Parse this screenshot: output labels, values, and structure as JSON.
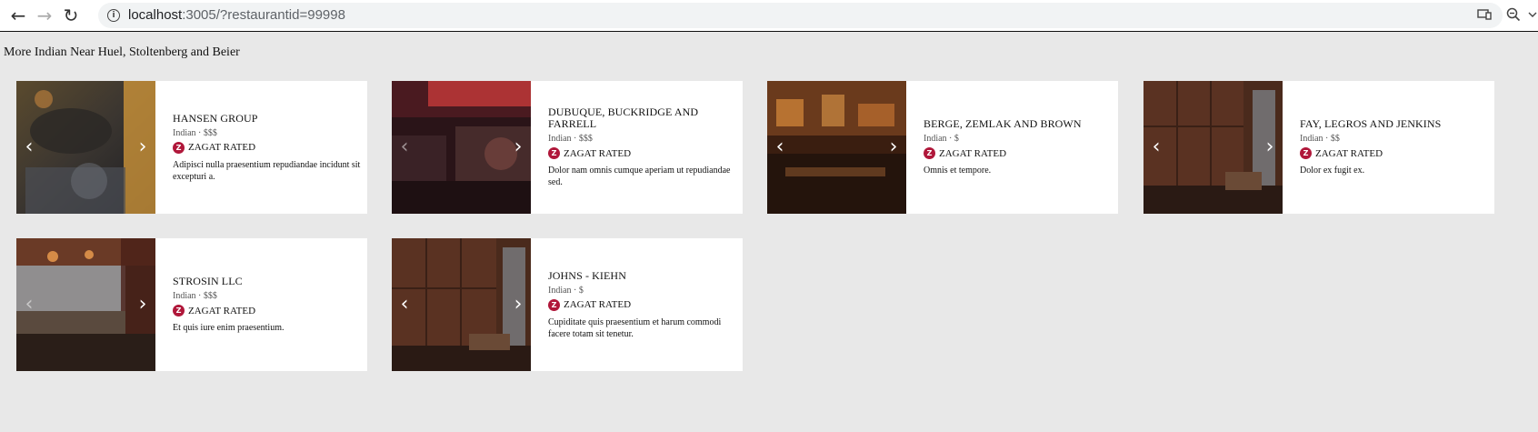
{
  "browser": {
    "back_icon": "←",
    "forward_icon": "→",
    "reload_icon": "↻",
    "url_host": "localhost",
    "url_path": ":3005/?restaurantid=99998"
  },
  "section": {
    "title": "More Indian Near Huel, Stoltenberg and Beier"
  },
  "zagat_label": "ZAGAT RATED",
  "cards": [
    {
      "name": "Hansen Group",
      "meta": "Indian · $$$",
      "zagat": "ZAGAT RATED",
      "description": "Adipisci nulla praesentium repudiandae incidunt sit excepturi a."
    },
    {
      "name": "Dubuque, Buckridge and Farrell",
      "meta": "Indian · $$$",
      "zagat": "ZAGAT RATED",
      "description": "Dolor nam omnis cumque aperiam ut repudiandae sed."
    },
    {
      "name": "Berge, Zemlak and Brown",
      "meta": "Indian · $",
      "zagat": "ZAGAT RATED",
      "description": "Omnis et tempore."
    },
    {
      "name": "Fay, Legros and Jenkins",
      "meta": "Indian · $$",
      "zagat": "ZAGAT RATED",
      "description": "Dolor ex fugit ex."
    },
    {
      "name": "Strosin LLC",
      "meta": "Indian · $$$",
      "zagat": "ZAGAT RATED",
      "description": "Et quis iure enim praesentium."
    },
    {
      "name": "Johns - Kiehn",
      "meta": "Indian · $",
      "zagat": "ZAGAT RATED",
      "description": "Cupiditate quis praesentium et harum commodi facere totam sit tenetur."
    }
  ],
  "carousel": {
    "prev_icon": "‹",
    "next_icon": "›"
  },
  "colors": {
    "page_background": "#e8e8e8",
    "card_background": "#ffffff",
    "zagat_red": "#b0173a"
  }
}
